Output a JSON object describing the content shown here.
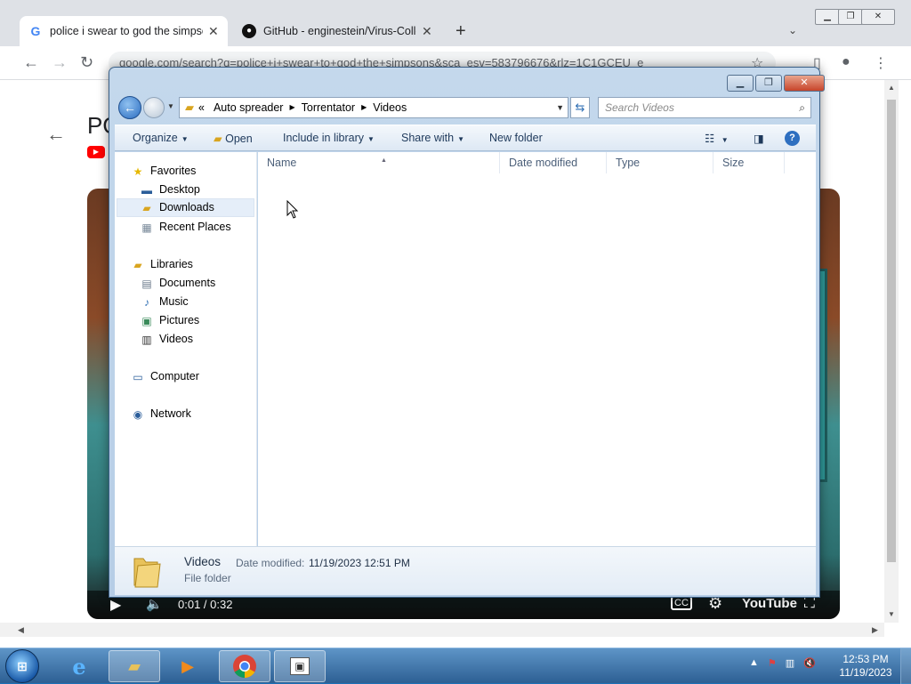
{
  "browser": {
    "tabs": [
      {
        "title": "police i swear to god the simpsons",
        "icon": "google-g-icon"
      },
      {
        "title": "GitHub - enginestein/Virus-Collection",
        "icon": "github-icon"
      }
    ],
    "url": "google.com/search?q=police+i+swear+to+god+the+simpsons&sca_esv=583796676&rlz=1C1GCEU_e",
    "page_title_fragment": "PO",
    "video": {
      "time": "0:01 / 0:32",
      "brand": "YouTube"
    }
  },
  "explorer": {
    "breadcrumb_prefix": "«",
    "breadcrumbs": [
      "Auto spreader",
      "Torrentator",
      "Videos"
    ],
    "search_placeholder": "Search Videos",
    "commands": {
      "organize": "Organize",
      "open": "Open",
      "include_in_library": "Include in library",
      "share_with": "Share with",
      "new_folder": "New folder"
    },
    "nav": {
      "favorites": "Favorites",
      "desktop": "Desktop",
      "downloads": "Downloads",
      "recent_places": "Recent Places",
      "libraries": "Libraries",
      "documents": "Documents",
      "music": "Music",
      "pictures": "Pictures",
      "videos": "Videos",
      "computer": "Computer",
      "network": "Network"
    },
    "columns": {
      "name": "Name",
      "date_modified": "Date modified",
      "type": "Type",
      "size": "Size"
    },
    "details": {
      "name": "Videos",
      "type": "File folder",
      "date_label": "Date modified:",
      "date_value": "11/19/2023 12:51 PM"
    }
  },
  "taskbar": {
    "clock_time": "12:53 PM",
    "clock_date": "11/19/2023"
  }
}
